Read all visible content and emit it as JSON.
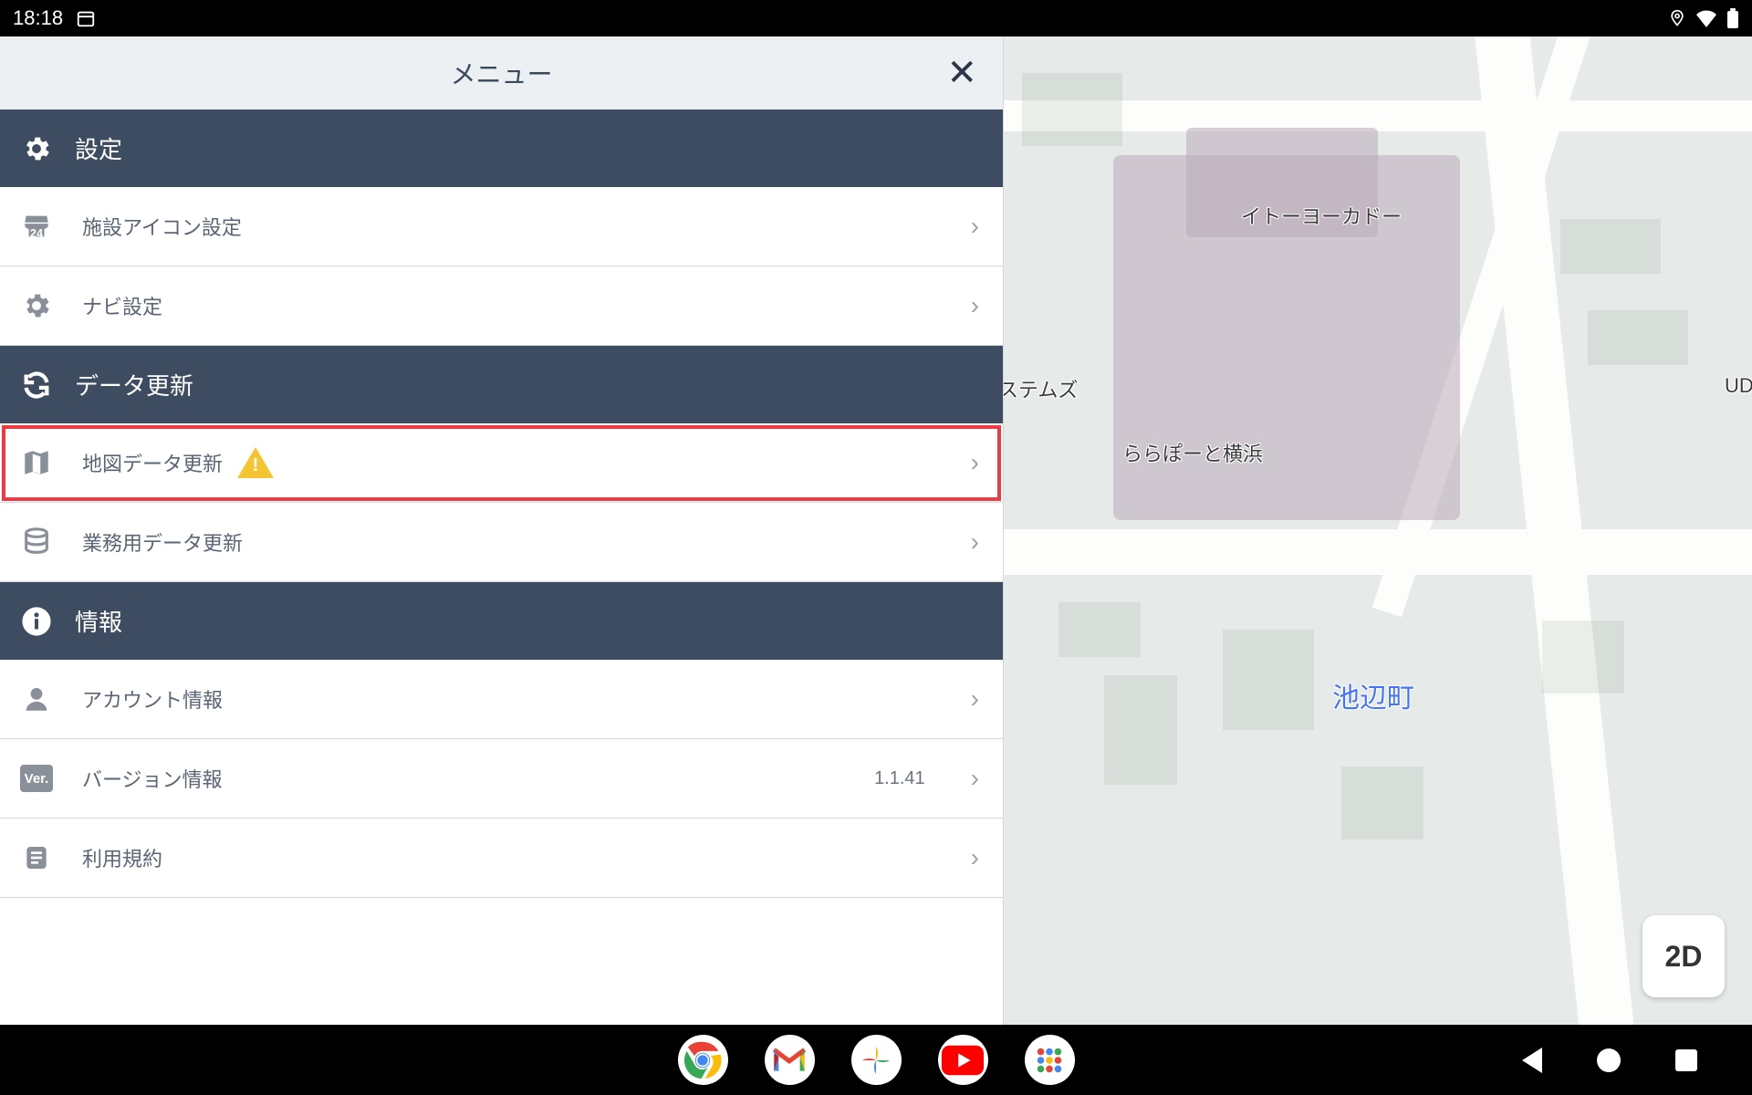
{
  "status": {
    "time": "18:18"
  },
  "menu": {
    "title": "メニュー",
    "sections": {
      "settings": {
        "label": "設定",
        "items": {
          "facility": {
            "label": "施設アイコン設定"
          },
          "navi": {
            "label": "ナビ設定"
          }
        }
      },
      "update": {
        "label": "データ更新",
        "items": {
          "map": {
            "label": "地図データ更新"
          },
          "biz": {
            "label": "業務用データ更新"
          }
        }
      },
      "info": {
        "label": "情報",
        "items": {
          "account": {
            "label": "アカウント情報"
          },
          "version": {
            "label": "バージョン情報",
            "value": "1.1.41"
          },
          "terms": {
            "label": "利用規約"
          }
        }
      }
    }
  },
  "map": {
    "labels": {
      "itoyokado": "イトーヨーカドー",
      "lalaport": "ららぽーと横浜",
      "stems": "ステムズ",
      "ud": "UD",
      "ikebe": "池辺町"
    },
    "button2d": "2D"
  }
}
